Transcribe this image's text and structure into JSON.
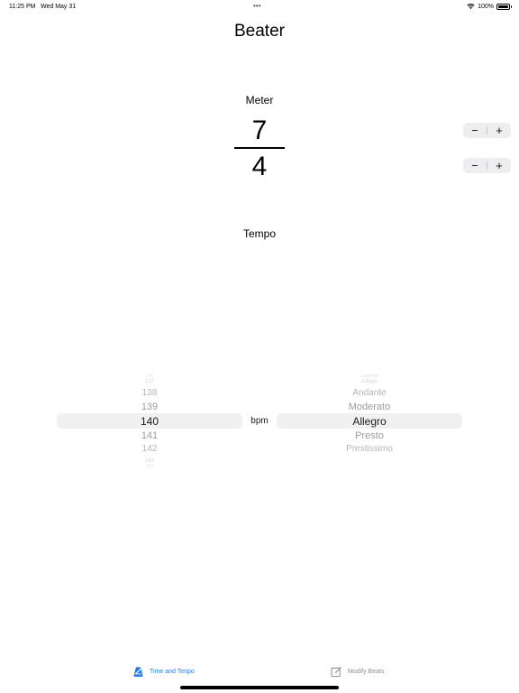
{
  "status_bar": {
    "time": "11:25 PM",
    "date": "Wed May 31",
    "multitask_dots": "•••",
    "battery_percent": "100%",
    "battery_level": 1.0
  },
  "app": {
    "title": "Beater"
  },
  "meter": {
    "label": "Meter",
    "numerator": "7",
    "denominator": "4",
    "decrement_label": "−",
    "increment_label": "+"
  },
  "tempo": {
    "label": "Tempo",
    "unit": "bpm",
    "bpm_picker": {
      "items": [
        "136",
        "137",
        "138",
        "139",
        "140",
        "141",
        "142",
        "143",
        "144"
      ],
      "selected": "140"
    },
    "name_picker": {
      "items": [
        "Larghetto",
        "Adagio",
        "Andante",
        "Moderato",
        "Allegro",
        "Presto",
        "Prestissimo",
        "",
        ""
      ],
      "selected": "Allegro"
    }
  },
  "tab_bar": {
    "tabs": [
      {
        "label": "Time and Tenpo",
        "icon": "metronome-icon",
        "active": true
      },
      {
        "label": "Modify Beats",
        "icon": "edit-icon",
        "active": false
      }
    ]
  },
  "colors": {
    "accent": "#1a7cf5",
    "inactive": "#8e8e93",
    "stepper_bg": "#eeeef0",
    "picker_selection": "#f0f0f2"
  }
}
